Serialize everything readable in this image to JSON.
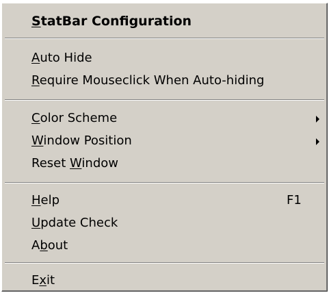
{
  "menu": {
    "header": {
      "pre": "",
      "key": "S",
      "post": "tatBar Configuration"
    },
    "auto_hide": {
      "pre": "",
      "key": "A",
      "post": "uto Hide"
    },
    "require_mouseclick": {
      "pre": "",
      "key": "R",
      "post": "equire Mouseclick When Auto-hiding"
    },
    "color_scheme": {
      "pre": "",
      "key": "C",
      "post": "olor Scheme"
    },
    "window_position": {
      "pre": "",
      "key": "W",
      "post": "indow Position"
    },
    "reset_window": {
      "pre": "Reset ",
      "key": "W",
      "post": "indow"
    },
    "help": {
      "pre": "",
      "key": "H",
      "post": "elp",
      "shortcut": "F1"
    },
    "update_check": {
      "pre": "",
      "key": "U",
      "post": "pdate Check"
    },
    "about": {
      "pre": "A",
      "key": "b",
      "post": "out"
    },
    "exit": {
      "pre": "E",
      "key": "x",
      "post": "it"
    }
  },
  "icons": {
    "submenu_arrow": "submenu-arrow-icon"
  },
  "colors": {
    "menu_background": "#d4d0c8",
    "separator_shadow": "#808080",
    "separator_highlight": "#ffffff",
    "text": "#000000"
  }
}
